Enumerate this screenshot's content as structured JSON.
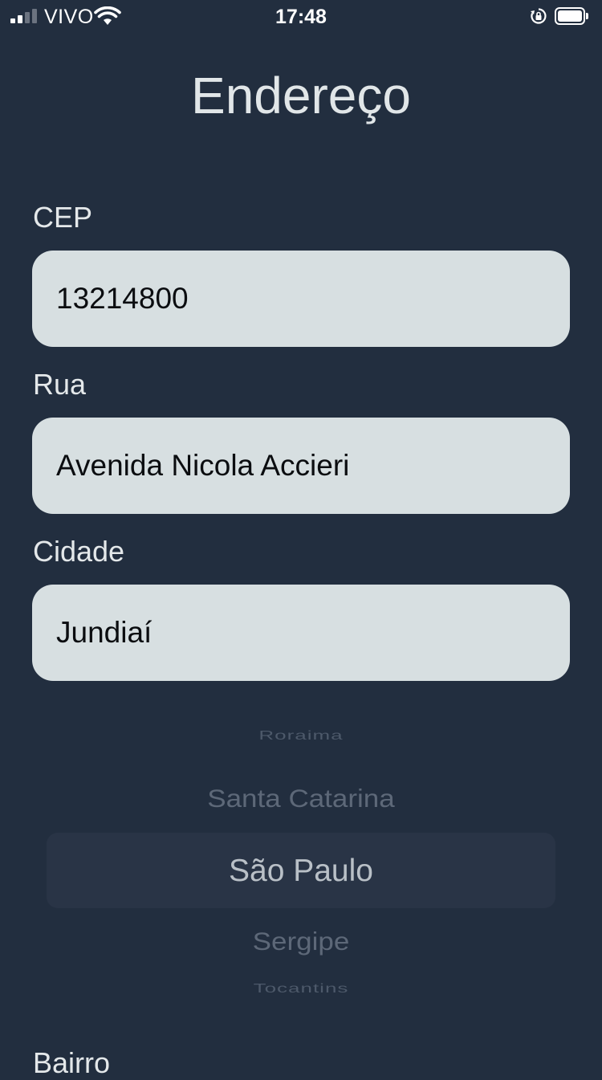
{
  "status_bar": {
    "carrier": "VIVO",
    "time": "17:48",
    "signal_bars_filled": 2,
    "signal_bars_total": 4,
    "battery_level": 1.0,
    "icons": [
      "signal-icon",
      "wifi-icon",
      "rotation-lock-icon",
      "battery-icon"
    ]
  },
  "page": {
    "title": "Endereço"
  },
  "form": {
    "cep": {
      "label": "CEP",
      "value": "13214800"
    },
    "rua": {
      "label": "Rua",
      "value": "Avenida Nicola Accieri"
    },
    "cidade": {
      "label": "Cidade",
      "value": "Jundiaí"
    },
    "bairro": {
      "label": "Bairro"
    }
  },
  "state_picker": {
    "options": [
      "Roraima",
      "Santa Catarina",
      "São Paulo",
      "Sergipe",
      "Tocantins"
    ],
    "selected": "São Paulo"
  },
  "colors": {
    "background": "#222e3f",
    "input_background": "#d7dfe1",
    "text_light": "#e4e8ea",
    "picker_highlight": "#293446"
  }
}
